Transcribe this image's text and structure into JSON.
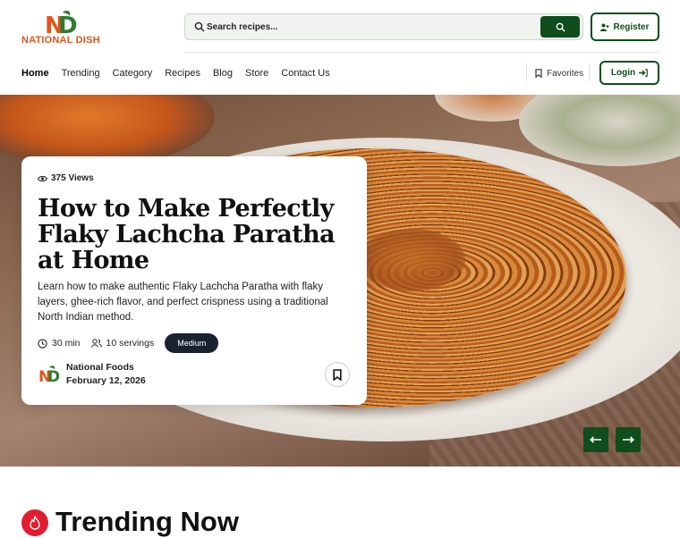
{
  "brand": {
    "name": "NATIONAL DISH",
    "mark": "ND"
  },
  "search": {
    "placeholder": "Search recipes..."
  },
  "header": {
    "register_label": "Register",
    "login_label": "Login",
    "favorites_label": "Favorites"
  },
  "nav": {
    "items": [
      {
        "label": "Home",
        "active": true
      },
      {
        "label": "Trending"
      },
      {
        "label": "Category"
      },
      {
        "label": "Recipes"
      },
      {
        "label": "Blog"
      },
      {
        "label": "Store"
      },
      {
        "label": "Contact Us"
      }
    ]
  },
  "hero": {
    "views": "375 Views",
    "title": "How to Make Perfectly Flaky Lachcha Paratha at Home",
    "description": "Learn how to make authentic Flaky Lachcha Paratha with flaky layers, ghee-rich flavor, and perfect crispness using a traditional North Indian method.",
    "time": "30 min",
    "servings": "10 servings",
    "difficulty": "Medium",
    "author": "National Foods",
    "date": "February 12, 2026",
    "prev_arrow": "⟵",
    "next_arrow": "⟶"
  },
  "trending": {
    "title": "Trending Now"
  },
  "colors": {
    "brand_green": "#0f4d1d",
    "brand_orange": "#e5531a",
    "trend_red": "#e11d2f",
    "badge_dark": "#1b2130"
  }
}
